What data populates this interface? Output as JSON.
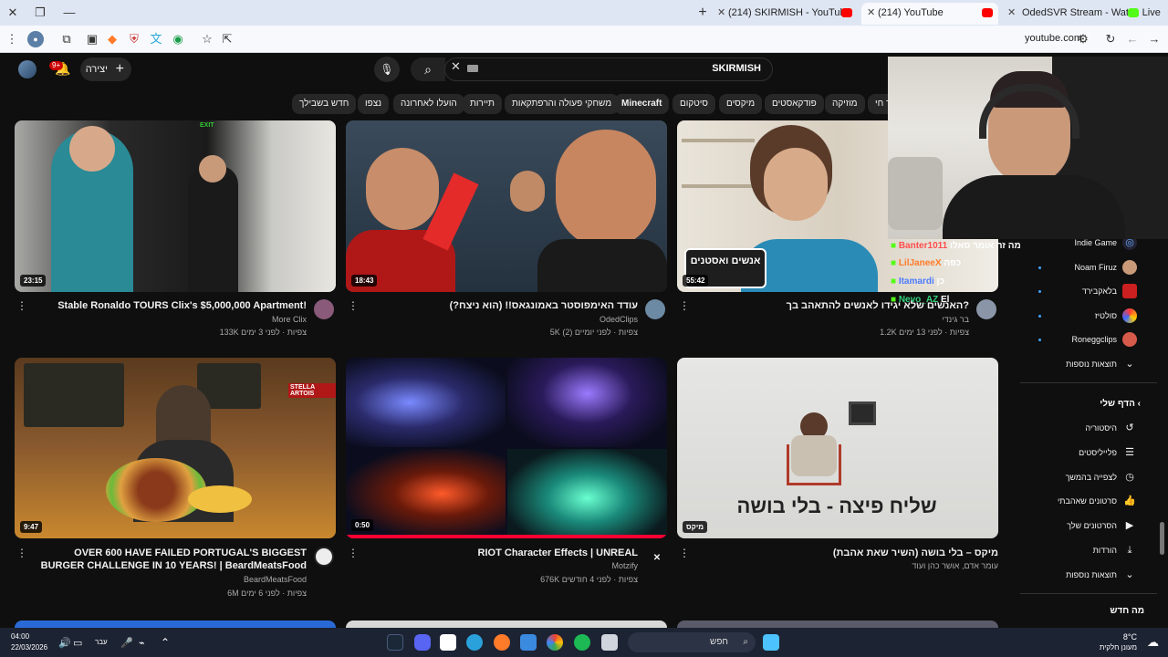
{
  "browser": {
    "tabs": [
      {
        "title": "OdedSVR Stream - Watch Live"
      },
      {
        "title": "(214) YouTube"
      },
      {
        "title": "(214) SKIRMISH - YouTube"
      }
    ],
    "url": "youtube.com"
  },
  "header": {
    "search_value": "SKIRMISH",
    "create_label": "יצירה",
    "notif_count": "9+"
  },
  "chips": [
    "חדש בשבילך",
    "נצפו",
    "הועלו לאחרונה",
    "תיירות",
    "משחקי פעולה והרפתקאות",
    "Minecraft",
    "סיטקום",
    "מיקסים",
    "פודקאסטים",
    "מוזיקה",
    "ר חי"
  ],
  "videos": [
    {
      "title": "Stable Ronaldo TOURS Clix's $5,000,000 Apartment!",
      "channel": "More Clix",
      "meta": "133K צפיות · לפני 3 ימים",
      "duration": "23:15"
    },
    {
      "title": "עודד האימפוסטר באמונגאס!! (הוא ניצח?)",
      "channel": "OdedClips",
      "meta": "5K צפיות · לפני יומיים (2)",
      "duration": "18:43"
    },
    {
      "title": "האנשים שלא יגידו לאנשים להתאהב בך?",
      "channel": "בר גינדי",
      "meta": "1.2K צפיות · לפני 13 ימים",
      "duration": "55:42"
    },
    {
      "title": "OVER 600 HAVE FAILED PORTUGAL'S BIGGEST BURGER CHALLENGE IN 10 YEARS! | BeardMeatsFood",
      "channel": "BeardMeatsFood",
      "meta": "6M צפיות · לפני 6 ימים",
      "duration": "9:47"
    },
    {
      "title": "RIOT Character Effects | UNREAL",
      "channel": "Motzify",
      "meta": "676K צפיות · לפני 4 חודשים",
      "duration": "0:50"
    },
    {
      "title": "מיקס – בלי בושה (השיר שאת אהבת)",
      "channel": "עומר אדם, אושר כהן ועוד",
      "meta": "",
      "duration": "מיקס"
    }
  ],
  "thumb_texts": {
    "exit": "EXIT",
    "anashim": "אנשים ואסטנים",
    "pizza": "שליח פיצה - בלי בושה",
    "beer": "STELLA ARTOIS"
  },
  "sidebar": {
    "subs": [
      {
        "label": "Indie Game"
      },
      {
        "label": "Noam Firuz"
      },
      {
        "label": "בלאקבירד"
      },
      {
        "label": "סולטיז"
      },
      {
        "label": "Roneggclips"
      }
    ],
    "more1": "תוצאות נוספות",
    "you_head": "הדף שלי",
    "you_items": [
      {
        "label": "היסטוריה",
        "icon": "↺"
      },
      {
        "label": "פלייליסטים",
        "icon": "☰"
      },
      {
        "label": "לצפייה בהמשך",
        "icon": "◷"
      },
      {
        "label": "סרטונים שאהבתי",
        "icon": "👍"
      },
      {
        "label": "הסרטונים שלך",
        "icon": "▶"
      },
      {
        "label": "הורדות",
        "icon": "⤓"
      }
    ],
    "more2": "תוצאות נוספות",
    "whats_new": "מה חדש"
  },
  "chat": [
    {
      "user": "Banter1011",
      "text": "מה זה אומר סאלו",
      "color": "#ff4d4d"
    },
    {
      "user": "LilJaneeX",
      "text": "כפה",
      "color": "#ff7a29"
    },
    {
      "user": "Itamardi",
      "text": "כן",
      "color": "#4d7cff"
    },
    {
      "user": "Nevo_AZ",
      "text": "El",
      "color": "#33d17a"
    }
  ],
  "taskbar": {
    "time": "04:00",
    "date": "22/03/2026",
    "lang": "עבר",
    "search": "חפש",
    "weather_temp": "8°C",
    "weather_desc": "מעונן חלקית"
  }
}
